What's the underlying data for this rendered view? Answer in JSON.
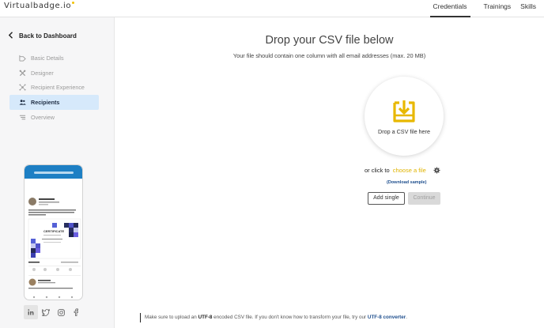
{
  "header": {
    "logo_text": "Virtualbadge.io",
    "nav": [
      "Credentials",
      "Trainings",
      "Skills"
    ],
    "accent_color": "#f2c200"
  },
  "sidebar": {
    "back_label": "Back to Dashboard",
    "items": [
      {
        "label": "Basic Details",
        "icon": "hanger-icon",
        "active": false
      },
      {
        "label": "Designer",
        "icon": "tools-icon",
        "active": false
      },
      {
        "label": "Recipient Experience",
        "icon": "network-icon",
        "active": false
      },
      {
        "label": "Recipients",
        "icon": "people-icon",
        "active": true
      },
      {
        "label": "Overview",
        "icon": "list-icon",
        "active": false
      }
    ],
    "preview": {
      "certificate_label": "CERTIFICATE",
      "social_icons": [
        "linkedin-icon",
        "twitter-icon",
        "instagram-icon",
        "facebook-icon"
      ]
    }
  },
  "main": {
    "title": "Drop your CSV file below",
    "subtitle": "Your file should contain one column with all email addresses (max. 20 MB)",
    "dropzone_text": "Drop a CSV file here",
    "or_click": "or click to",
    "choose_file": "choose a file",
    "download_sample": "(Download sample)",
    "add_single": "Add single",
    "continue": "Continue",
    "footnote": {
      "pre": "Make sure to upload an ",
      "utf8": "UTF-8",
      "mid": " encoded CSV file. If you don't know how to transform your file, try our ",
      "link": "UTF-8 converter",
      "post": "."
    }
  },
  "colors": {
    "active_bg": "#d6e9fb",
    "link_blue": "#1f4f8e",
    "yellow": "#e0b400"
  }
}
